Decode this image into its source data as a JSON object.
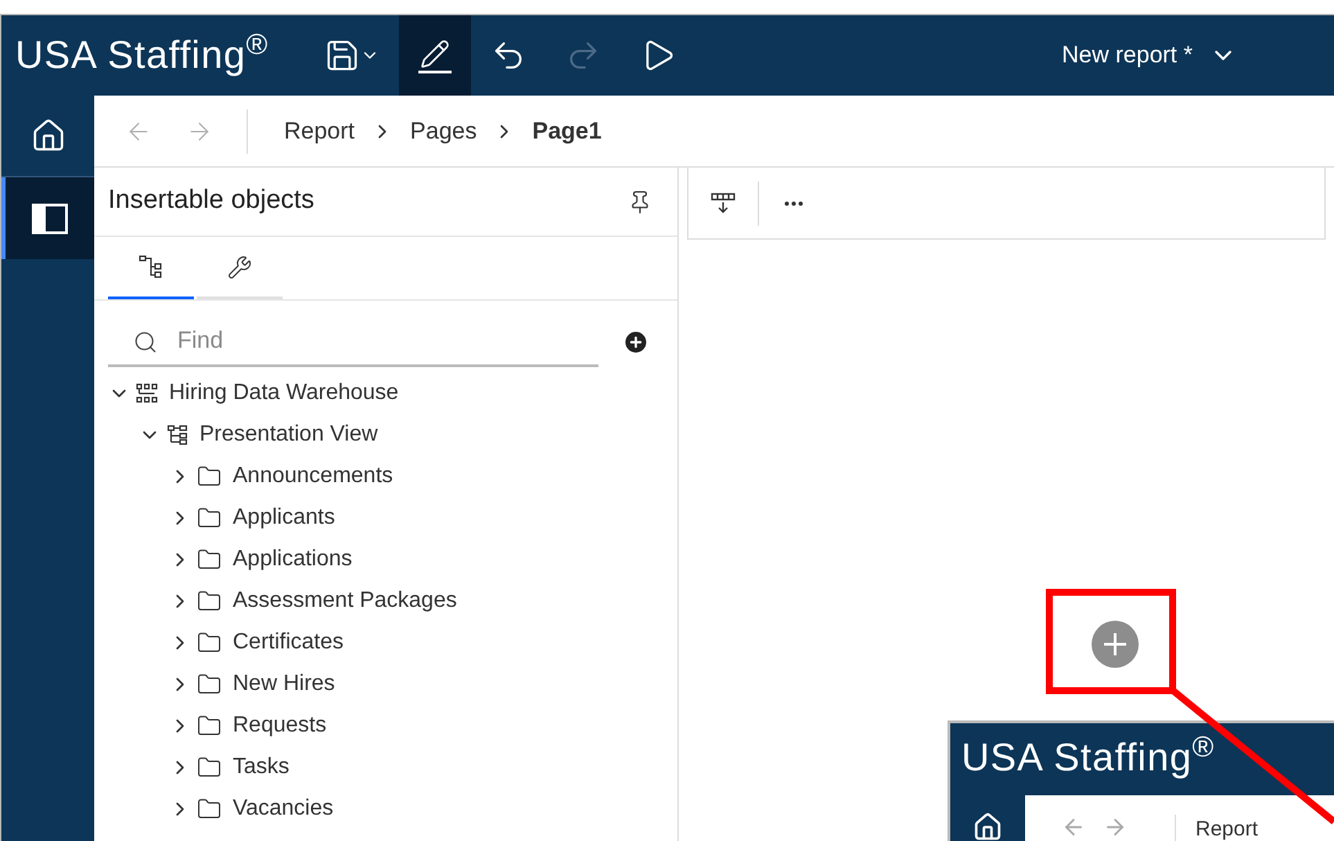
{
  "header": {
    "logo": "USA Staffing$^{®}$",
    "tools": [
      {
        "kind": "save",
        "selected": false,
        "disabled": false
      },
      {
        "kind": "edit",
        "selected": true,
        "disabled": false
      },
      {
        "kind": "undo",
        "selected": false,
        "disabled": false
      },
      {
        "kind": "redo",
        "selected": false,
        "disabled": true
      },
      {
        "kind": "run",
        "selected": false,
        "disabled": false
      }
    ],
    "report_menu": "New report *"
  },
  "rail": [
    {
      "kind": "home",
      "selected": false
    },
    {
      "kind": "panel",
      "selected": true
    }
  ],
  "breadcrumb": {
    "back_disabled": true,
    "forward_disabled": true,
    "items": [
      {
        "label": "Report",
        "current": false
      },
      {
        "label": "Pages",
        "current": false
      },
      {
        "label": "Page1",
        "current": true
      }
    ]
  },
  "panel": {
    "title": "Insertable objects",
    "tabs": [
      {
        "kind": "source",
        "selected": true
      },
      {
        "kind": "toolbox",
        "selected": false
      }
    ],
    "search": {
      "placeholder": "Find"
    },
    "tree": [
      {
        "label": "Hiring Data Warehouse",
        "kind": "package",
        "expanded": true,
        "children": [
          {
            "label": "Presentation View",
            "kind": "namespace",
            "expanded": true,
            "children": [
              {
                "label": "Announcements",
                "kind": "folder",
                "expanded": false
              },
              {
                "label": "Applicants",
                "kind": "folder",
                "expanded": false
              },
              {
                "label": "Applications",
                "kind": "folder",
                "expanded": false
              },
              {
                "label": "Assessment Packages",
                "kind": "folder",
                "expanded": false
              },
              {
                "label": "Certificates",
                "kind": "folder",
                "expanded": false
              },
              {
                "label": "New Hires",
                "kind": "folder",
                "expanded": false
              },
              {
                "label": "Requests",
                "kind": "folder",
                "expanded": false
              },
              {
                "label": "Tasks",
                "kind": "folder",
                "expanded": false
              },
              {
                "label": "Vacancies",
                "kind": "folder",
                "expanded": false
              }
            ]
          }
        ]
      }
    ]
  },
  "inset": {
    "logo": "USA Staffing$^{®}$",
    "breadcrumb": "Report"
  }
}
